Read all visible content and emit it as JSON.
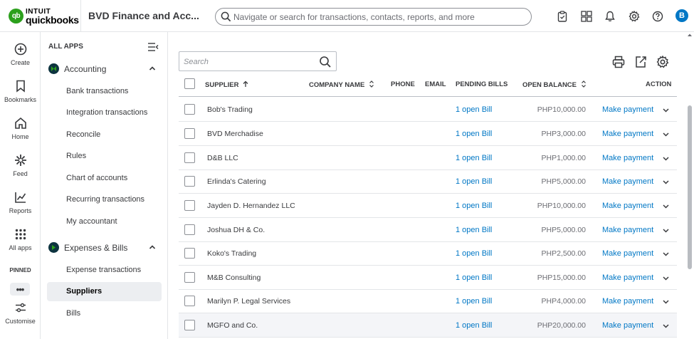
{
  "header": {
    "logo_intuit": "INTUIT",
    "logo_quickbooks": "quickbooks",
    "logo_mark": "qb",
    "company_name": "BVD Finance and Acc...",
    "search_placeholder": "Navigate or search for transactions, contacts, reports, and more",
    "icons": [
      "clipboard-icon",
      "apps-grid-icon",
      "bell-icon",
      "gear-icon",
      "help-icon"
    ],
    "avatar_initial": "B",
    "avatar_color": "#0077c5"
  },
  "rail": {
    "items": [
      {
        "label": "Create",
        "icon": "plus-circle-icon"
      },
      {
        "label": "Bookmarks",
        "icon": "bookmark-icon"
      },
      {
        "label": "Home",
        "icon": "home-icon"
      },
      {
        "label": "Feed",
        "icon": "sparkle-icon"
      },
      {
        "label": "Reports",
        "icon": "chart-icon"
      },
      {
        "label": "All apps",
        "icon": "dots-grid-icon"
      }
    ],
    "pinned_label": "PINNED",
    "more_label": "•••",
    "customise_label": "Customise"
  },
  "sidenav": {
    "title": "ALL APPS",
    "accounting": {
      "label": "Accounting",
      "links": [
        "Bank transactions",
        "Integration transactions",
        "Reconcile",
        "Rules",
        "Chart of accounts",
        "Recurring transactions",
        "My accountant"
      ]
    },
    "expenses": {
      "label": "Expenses & Bills",
      "links": [
        "Expense transactions",
        "Suppliers",
        "Bills"
      ],
      "active": "Suppliers"
    }
  },
  "table": {
    "search_placeholder": "Search",
    "columns": {
      "supplier": "SUPPLIER",
      "company": "COMPANY NAME",
      "phone": "PHONE",
      "email": "EMAIL",
      "pending": "PENDING BILLS",
      "balance": "OPEN BALANCE",
      "action": "ACTION"
    },
    "rows": [
      {
        "supplier": "Bob's Trading",
        "pending": "1 open Bill",
        "balance": "PHP10,000.00",
        "action": "Make payment"
      },
      {
        "supplier": "BVD Merchadise",
        "pending": "1 open Bill",
        "balance": "PHP3,000.00",
        "action": "Make payment"
      },
      {
        "supplier": "D&B LLC",
        "pending": "1 open Bill",
        "balance": "PHP1,000.00",
        "action": "Make payment"
      },
      {
        "supplier": "Erlinda's Catering",
        "pending": "1 open Bill",
        "balance": "PHP5,000.00",
        "action": "Make payment"
      },
      {
        "supplier": "Jayden D. Hernandez LLC",
        "pending": "1 open Bill",
        "balance": "PHP10,000.00",
        "action": "Make payment"
      },
      {
        "supplier": "Joshua DH & Co.",
        "pending": "1 open Bill",
        "balance": "PHP5,000.00",
        "action": "Make payment"
      },
      {
        "supplier": "Koko's Trading",
        "pending": "1 open Bill",
        "balance": "PHP2,500.00",
        "action": "Make payment"
      },
      {
        "supplier": "M&B Consulting",
        "pending": "1 open Bill",
        "balance": "PHP15,000.00",
        "action": "Make payment"
      },
      {
        "supplier": "Marilyn P. Legal Services",
        "pending": "1 open Bill",
        "balance": "PHP4,000.00",
        "action": "Make payment"
      },
      {
        "supplier": "MGFO and Co.",
        "pending": "1 open Bill",
        "balance": "PHP20,000.00",
        "action": "Make payment"
      }
    ]
  },
  "colors": {
    "brand_green": "#2ca01c",
    "link_blue": "#0077c5",
    "text": "#393a3d",
    "nav_active_bg": "#eceef1"
  }
}
